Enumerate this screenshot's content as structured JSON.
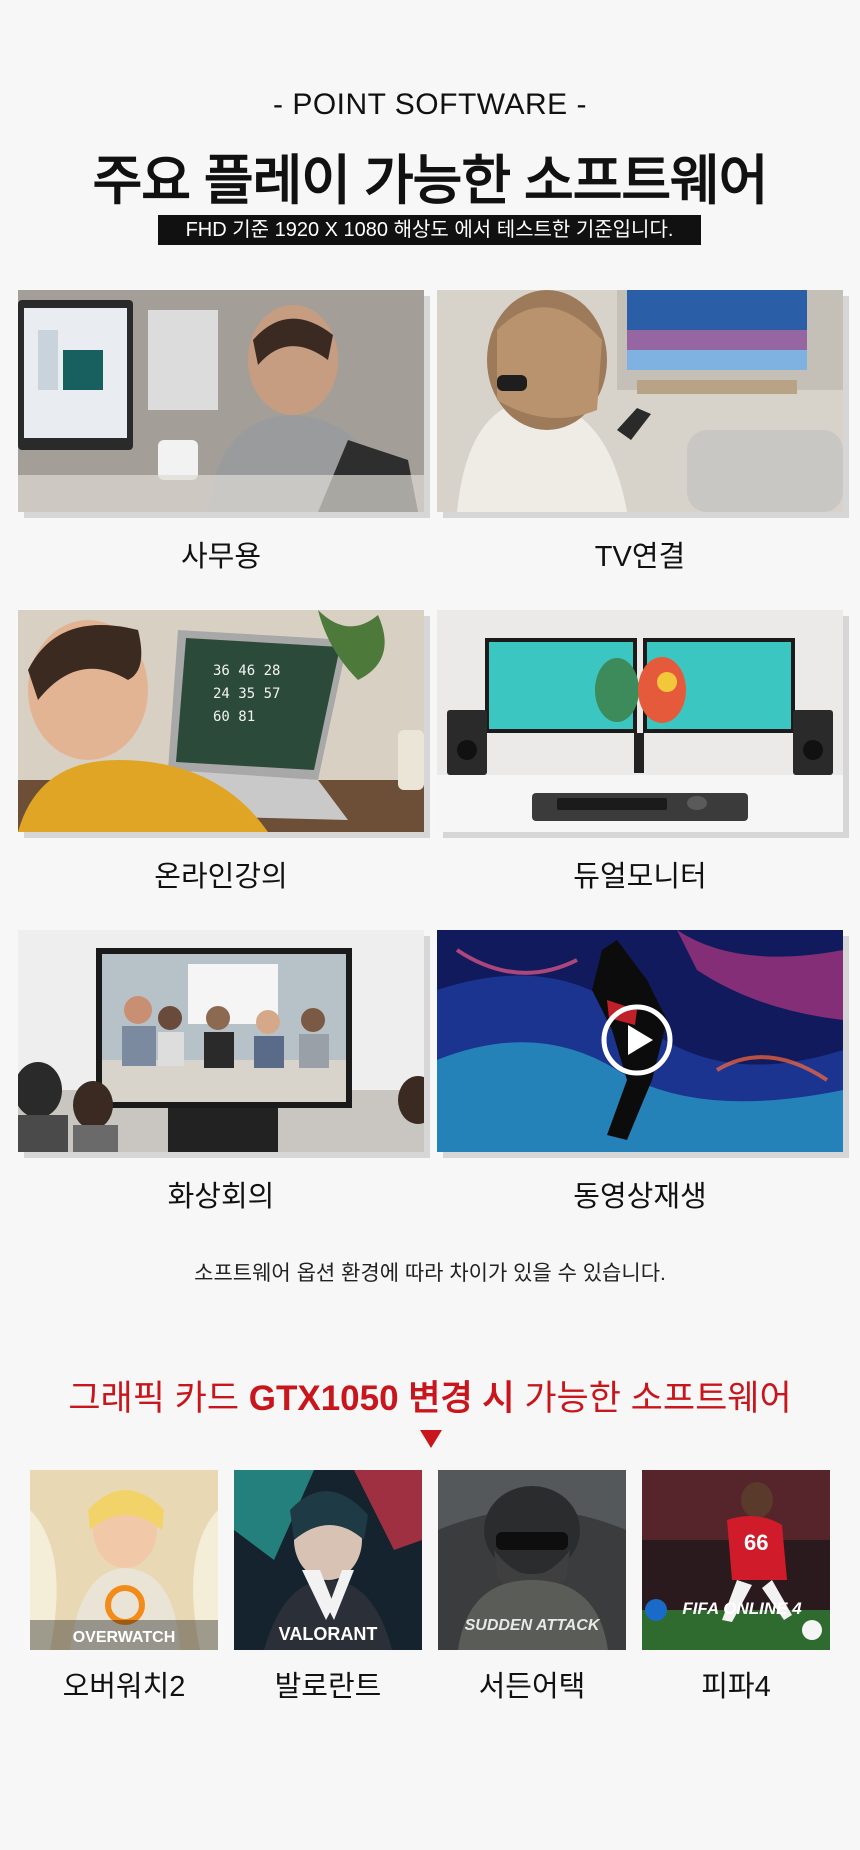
{
  "header": {
    "subtitle": "- POINT SOFTWARE -",
    "title": "주요 플레이 가능한 소프트웨어",
    "note": "FHD 기준 1920 X 1080 해상도 에서 테스트한 기준입니다."
  },
  "tiles": [
    {
      "label": "사무용"
    },
    {
      "label": "TV연결"
    },
    {
      "label": "온라인강의"
    },
    {
      "label": "듀얼모니터"
    },
    {
      "label": "화상회의"
    },
    {
      "label": "동영상재생"
    }
  ],
  "footnote": "소프트웨어 옵션 환경에 따라 차이가 있을 수 있습니다.",
  "gpu_section": {
    "title_part1": "그래픽 카드 ",
    "title_bold": "GTX1050 변경 시",
    "title_part2": " 가능한 소프트웨어"
  },
  "games": [
    {
      "label": "오버워치2",
      "logo_text": "OVERWATCH"
    },
    {
      "label": "발로란트",
      "logo_text": "VALORANT"
    },
    {
      "label": "서든어택",
      "logo_text": "SUDDEN ATTACK"
    },
    {
      "label": "피파4",
      "logo_text": "FIFA ONLINE 4",
      "jersey_number": "66"
    }
  ],
  "colors": {
    "accent_red": "#c8161c",
    "note_bar_bg": "#111111",
    "page_bg": "#f7f7f7"
  }
}
